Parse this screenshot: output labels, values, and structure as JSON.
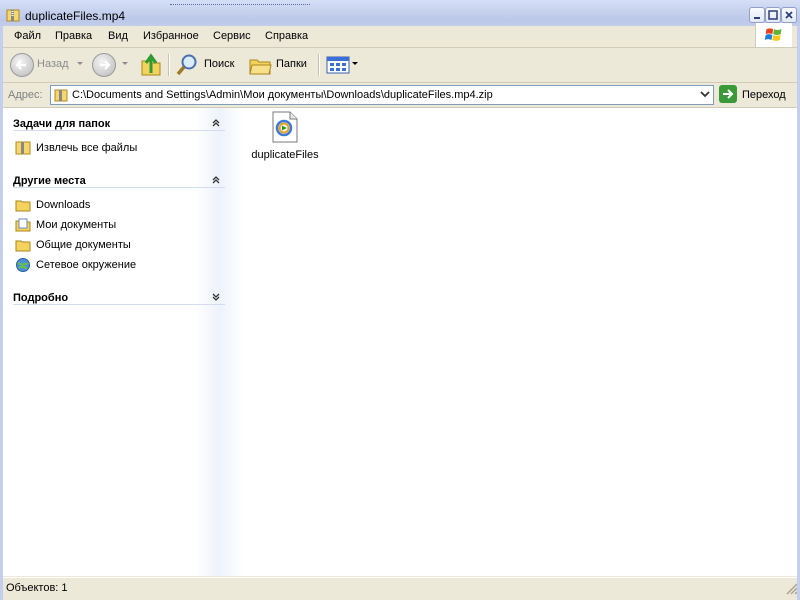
{
  "window": {
    "title": "duplicateFiles.mp4"
  },
  "menu": {
    "items": [
      "Файл",
      "Правка",
      "Вид",
      "Избранное",
      "Сервис",
      "Справка"
    ]
  },
  "toolbar": {
    "back_label": "Назад",
    "search_label": "Поиск",
    "folders_label": "Папки"
  },
  "address": {
    "label": "Адрес:",
    "path": "C:\\Documents and Settings\\Admin\\Мои документы\\Downloads\\duplicateFiles.mp4.zip",
    "go_label": "Переход"
  },
  "tasks_panel": {
    "title": "Задачи для папок",
    "items": [
      {
        "label": "Извлечь все файлы",
        "icon": "zip-folder-icon"
      }
    ]
  },
  "places_panel": {
    "title": "Другие места",
    "items": [
      {
        "label": "Downloads",
        "icon": "folder-icon"
      },
      {
        "label": "Мои документы",
        "icon": "my-documents-icon"
      },
      {
        "label": "Общие документы",
        "icon": "folder-icon"
      },
      {
        "label": "Сетевое окружение",
        "icon": "network-icon"
      }
    ]
  },
  "details_panel": {
    "title": "Подробно"
  },
  "files": [
    {
      "name": "duplicateFiles",
      "icon": "media-file-icon"
    }
  ],
  "status": {
    "text": "Объектов: 1"
  },
  "colors": {
    "title_bar": "#c8d3ef",
    "chrome": "#ece9d8",
    "go_button": "#3a9a3a"
  }
}
